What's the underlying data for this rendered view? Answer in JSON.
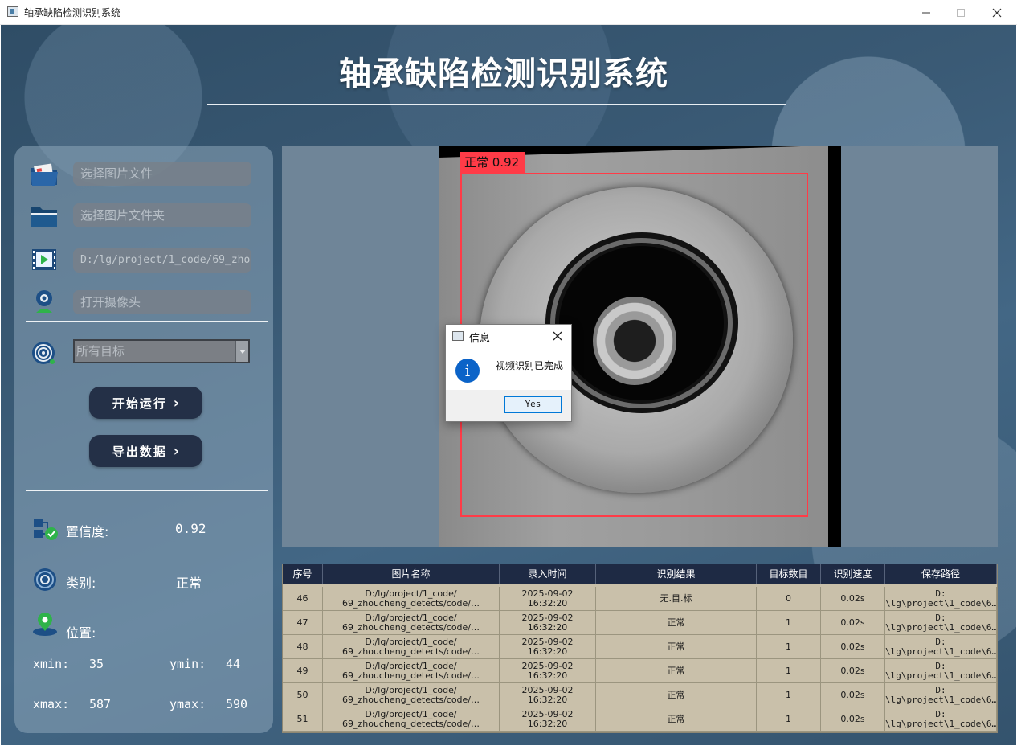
{
  "window": {
    "title": "轴承缺陷检测识别系统"
  },
  "header": {
    "title": "轴承缺陷检测识别系统"
  },
  "left_panel": {
    "image_file_placeholder": "选择图片文件",
    "image_folder_placeholder": "选择图片文件夹",
    "video_path": "D:/lg/project/1_code/69_zho",
    "camera_placeholder": "打开摄像头",
    "target_select": "所有目标",
    "start_button": "开始运行",
    "export_button": "导出数据",
    "chevron": "›",
    "confidence_label": "置信度:",
    "confidence_value": "0.92",
    "class_label": "类别:",
    "class_value": "正常",
    "position_label": "位置:",
    "xmin_label": "xmin:",
    "xmin_value": "35",
    "ymin_label": "ymin:",
    "ymin_value": "44",
    "xmax_label": "xmax:",
    "xmax_value": "587",
    "ymax_label": "ymax:",
    "ymax_value": "590"
  },
  "detection": {
    "label": "正常 0.92",
    "box_color": "#ff3b47"
  },
  "table": {
    "headers": [
      "序号",
      "图片名称",
      "录入时间",
      "识别结果",
      "目标数目",
      "识别速度",
      "保存路径"
    ],
    "rows": [
      {
        "id": "46",
        "name1": "D:/lg/project/1_code/",
        "name2": "69_zhoucheng_detects/code/…",
        "date": "2025-09-02",
        "time": "16:32:20",
        "result": "无.目.标",
        "count": "0",
        "speed": "0.02s",
        "path1": "D:",
        "path2": "\\lg\\project\\1_code\\6…"
      },
      {
        "id": "47",
        "name1": "D:/lg/project/1_code/",
        "name2": "69_zhoucheng_detects/code/…",
        "date": "2025-09-02",
        "time": "16:32:20",
        "result": "正常",
        "count": "1",
        "speed": "0.02s",
        "path1": "D:",
        "path2": "\\lg\\project\\1_code\\6…"
      },
      {
        "id": "48",
        "name1": "D:/lg/project/1_code/",
        "name2": "69_zhoucheng_detects/code/…",
        "date": "2025-09-02",
        "time": "16:32:20",
        "result": "正常",
        "count": "1",
        "speed": "0.02s",
        "path1": "D:",
        "path2": "\\lg\\project\\1_code\\6…"
      },
      {
        "id": "49",
        "name1": "D:/lg/project/1_code/",
        "name2": "69_zhoucheng_detects/code/…",
        "date": "2025-09-02",
        "time": "16:32:20",
        "result": "正常",
        "count": "1",
        "speed": "0.02s",
        "path1": "D:",
        "path2": "\\lg\\project\\1_code\\6…"
      },
      {
        "id": "50",
        "name1": "D:/lg/project/1_code/",
        "name2": "69_zhoucheng_detects/code/…",
        "date": "2025-09-02",
        "time": "16:32:20",
        "result": "正常",
        "count": "1",
        "speed": "0.02s",
        "path1": "D:",
        "path2": "\\lg\\project\\1_code\\6…"
      },
      {
        "id": "51",
        "name1": "D:/lg/project/1_code/",
        "name2": "69_zhoucheng_detects/code/…",
        "date": "2025-09-02",
        "time": "16:32:20",
        "result": "正常",
        "count": "1",
        "speed": "0.02s",
        "path1": "D:",
        "path2": "\\lg\\project\\1_code\\6…"
      }
    ]
  },
  "dialog": {
    "title": "信息",
    "message": "视频识别已完成",
    "info_glyph": "i",
    "yes_button": "Yes"
  },
  "icons": {
    "folder_image": "folder-image-icon",
    "folder": "folder-icon",
    "video": "video-icon",
    "camera": "webcam-icon",
    "target": "target-icon",
    "confidence": "confidence-icon",
    "class": "class-icon",
    "position": "location-pin-icon"
  },
  "colors": {
    "button_bg": "#243047",
    "table_header_bg": "#1e2a44",
    "table_body_bg": "#c9c0aa",
    "accent_green": "#2fb34a",
    "dialog_info_blue": "#0b63c8"
  }
}
